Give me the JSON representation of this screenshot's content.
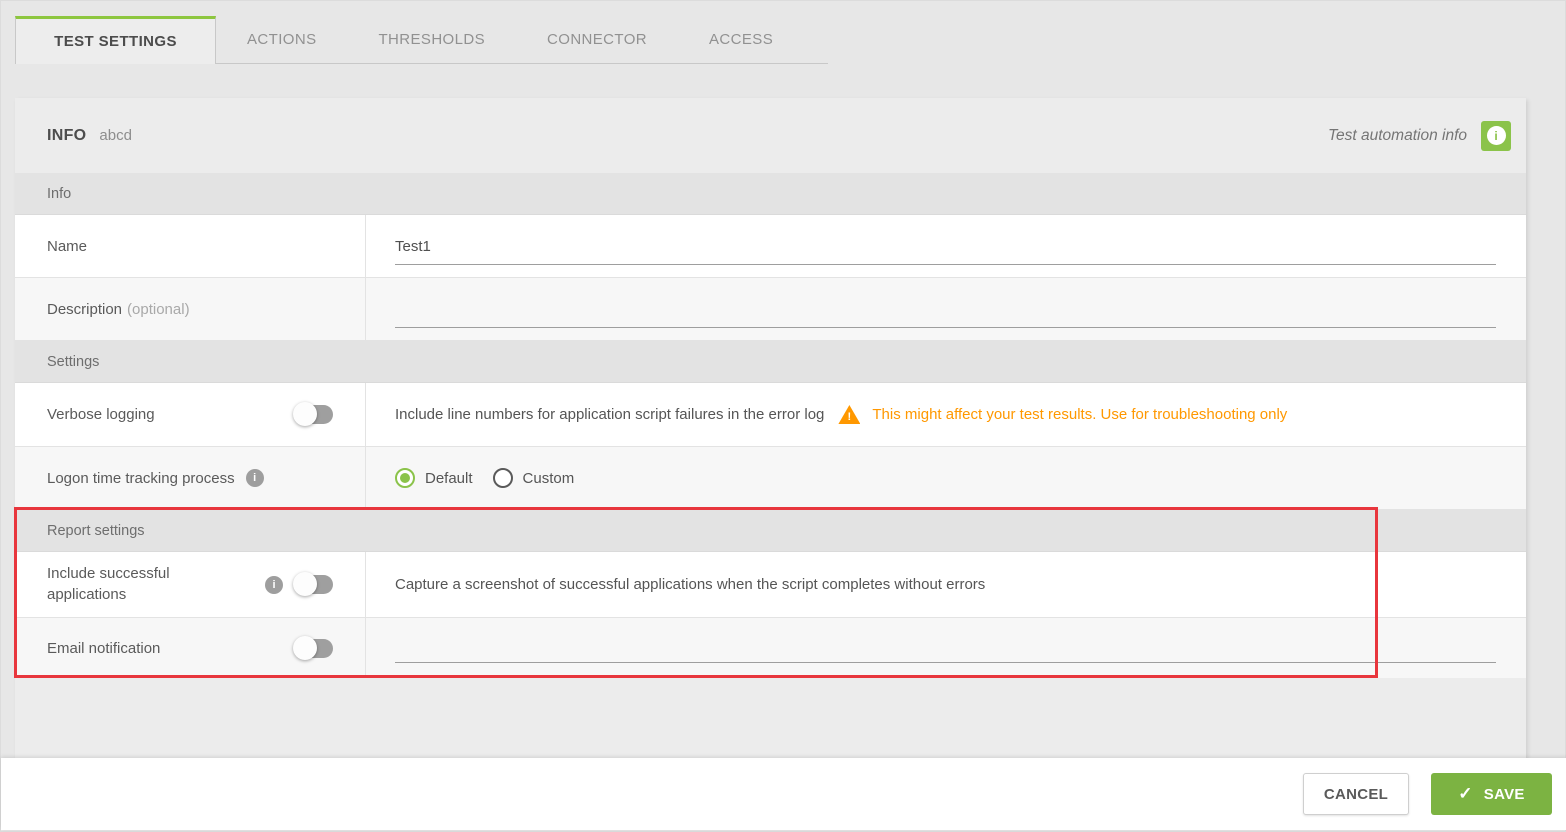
{
  "colors": {
    "accent_green": "#7cb342",
    "tab_green": "#8dc63f",
    "icon_green": "#8bc34a",
    "warning_orange": "#ff9800",
    "highlight_red": "#e8363d",
    "info_gray": "#9e9e9e"
  },
  "icons": {
    "info": "i",
    "warning": "!",
    "save_check": "✓"
  },
  "tabs": [
    {
      "label": "TEST SETTINGS",
      "active": true
    },
    {
      "label": "ACTIONS",
      "active": false
    },
    {
      "label": "THRESHOLDS",
      "active": false
    },
    {
      "label": "CONNECTOR",
      "active": false
    },
    {
      "label": "ACCESS",
      "active": false
    }
  ],
  "panel": {
    "title": "INFO",
    "subtitle": "abcd",
    "automation_label": "Test automation info",
    "sections": {
      "info": {
        "header": "Info",
        "name": {
          "label": "Name",
          "value": "Test1"
        },
        "description": {
          "label": "Description",
          "optional": "(optional)",
          "value": ""
        }
      },
      "settings": {
        "header": "Settings",
        "verbose": {
          "label": "Verbose logging",
          "toggle": "off",
          "description": "Include line numbers for application script failures in the error log",
          "warning": "This might affect your test results. Use for troubleshooting only"
        },
        "logon": {
          "label": "Logon time tracking process",
          "options": [
            {
              "label": "Default",
              "selected": true
            },
            {
              "label": "Custom",
              "selected": false
            }
          ]
        }
      },
      "report": {
        "header": "Report settings",
        "include": {
          "label": "Include successful applications",
          "toggle": "off",
          "description": "Capture a screenshot of successful applications when the script completes without errors"
        },
        "email": {
          "label": "Email notification",
          "toggle": "off",
          "value": ""
        }
      }
    }
  },
  "footer": {
    "cancel_label": "CANCEL",
    "save_label": "SAVE"
  }
}
